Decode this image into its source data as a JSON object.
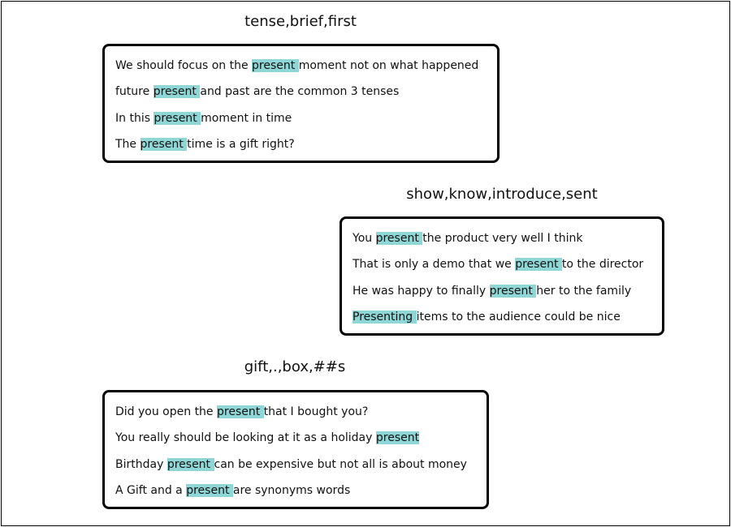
{
  "colors": {
    "highlight": "#8fd6d6",
    "border": "#000000"
  },
  "groups": [
    {
      "title": "tense,brief,first",
      "sentences": [
        {
          "before": "We should focus on the ",
          "word": "present ",
          "after": "moment not on what happened"
        },
        {
          "before": "future ",
          "word": "present ",
          "after": "and past are the common 3 tenses"
        },
        {
          "before": "In this ",
          "word": "present ",
          "after": "moment in time"
        },
        {
          "before": "The ",
          "word": "present ",
          "after": "time is a gift right?"
        }
      ]
    },
    {
      "title": "show,know,introduce,sent",
      "sentences": [
        {
          "before": "You ",
          "word": "present ",
          "after": "the product very well I think"
        },
        {
          "before": "That is only a demo that we ",
          "word": "present ",
          "after": "to the director"
        },
        {
          "before": "He was happy to finally ",
          "word": "present ",
          "after": "her to the family"
        },
        {
          "before": "",
          "word": "Presenting ",
          "after": "items to the audience could be nice"
        }
      ]
    },
    {
      "title": "gift,.,box,##s",
      "sentences": [
        {
          "before": "Did you open the ",
          "word": "present ",
          "after": "that I bought you?"
        },
        {
          "before": "You really should be looking at it as a holiday ",
          "word": "present",
          "after": ""
        },
        {
          "before": "Birthday ",
          "word": "present ",
          "after": "can be expensive but not all is about money"
        },
        {
          "before": "A Gift and a ",
          "word": "present ",
          "after": "are synonyms words"
        }
      ]
    }
  ]
}
